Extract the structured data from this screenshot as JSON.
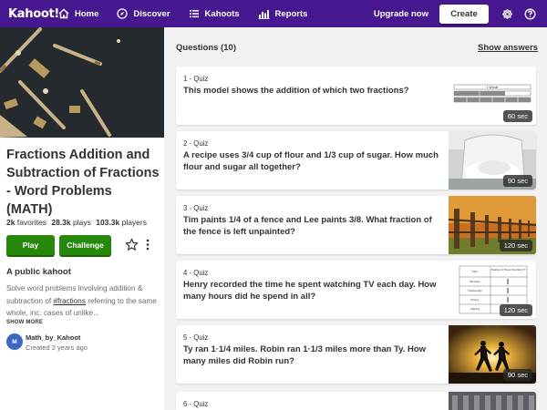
{
  "nav": {
    "logo": "Kahoot!",
    "items": [
      {
        "label": "Home"
      },
      {
        "label": "Discover"
      },
      {
        "label": "Kahoots"
      },
      {
        "label": "Reports"
      }
    ],
    "upgrade_label": "Upgrade now",
    "create_label": "Create"
  },
  "kahoot": {
    "title": "Fractions Addition and Subtraction of Fractions - Word Problems (MATH)",
    "favorites_count": "2k",
    "favorites_label": "favorites",
    "plays_count": "28.3k",
    "plays_label": "plays",
    "players_count": "103.3k",
    "players_label": "players",
    "play_label": "Play",
    "challenge_label": "Challenge",
    "public_heading": "A public kahoot",
    "desc_before": "Solve word problems involving addition & subtraction of ",
    "desc_tag": "#fractions",
    "desc_after": " referring to the same whole, inc. cases of unlike...",
    "show_more": "SHOW MORE",
    "author": "Math_by_Kahoot",
    "created": "Created 2 years ago",
    "avatar_initial": "M"
  },
  "questions_header": "Questions (10)",
  "show_answers": "Show answers",
  "questions": [
    {
      "type": "1 - Quiz",
      "text": "This model shows the addition of which two fractions?",
      "time": "60 sec",
      "thumb_label": "1 Whole"
    },
    {
      "type": "2 - Quiz",
      "text": "A recipe uses 3/4 cup of flour and 1/3 cup of sugar. How much flour and sugar all together?",
      "time": "90 sec"
    },
    {
      "type": "3 - Quiz",
      "text": "Tim paints 1/4 of a fence and Lee paints 3/8. What fraction of the fence is left unpainted?",
      "time": "120 sec"
    },
    {
      "type": "4 - Quiz",
      "text": "Henry recorded the time he spent watching TV each day. How many hours did he spend in all?",
      "time": "120 sec",
      "table": {
        "col1": "Day",
        "col2": "Number of Hours Watching TV",
        "rows": [
          "Monday",
          "Wednesday",
          "Friday",
          "Sunday"
        ]
      }
    },
    {
      "type": "5 - Quiz",
      "text": "Ty ran 1·1/4 miles. Robin ran 1·1/3 miles more than Ty. How many miles did Robin run?",
      "time": "90 sec"
    },
    {
      "type": "6 - Quiz"
    }
  ],
  "colors": {
    "nav": "#46178f",
    "green": "#26890c",
    "background": "#f2f2f2"
  }
}
